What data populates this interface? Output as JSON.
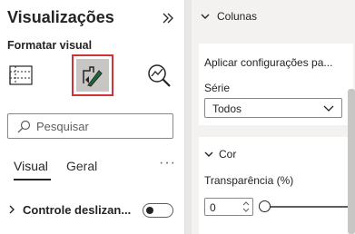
{
  "left_pane": {
    "title": "Visualizações",
    "subtitle": "Formatar visual",
    "search": {
      "placeholder": "Pesquisar"
    },
    "tabs": [
      {
        "label": "Visual",
        "selected": true
      },
      {
        "label": "Geral",
        "selected": false
      }
    ],
    "more_label": "···",
    "slider_section": {
      "label": "Controle deslizan...",
      "toggle_on": false
    }
  },
  "right_pane": {
    "section_header": "Colunas",
    "apply_card": {
      "title": "Aplicar configurações pa...",
      "series_label": "Série",
      "series_value": "Todos"
    },
    "color_card": {
      "title": "Cor",
      "transparency_label": "Transparência (%)",
      "transparency_value": "0"
    }
  },
  "icons": [
    "collapse-pane-icon",
    "build-visual-icon",
    "format-visual-icon",
    "analytics-icon",
    "search-icon",
    "chevron-right-icon",
    "chevron-down-icon",
    "dropdown-chevron-icon",
    "spin-arrows-icon"
  ],
  "colors": {
    "selected_border": "#d13438",
    "pane_bg": "#f3f2f1",
    "text": "#252423"
  }
}
